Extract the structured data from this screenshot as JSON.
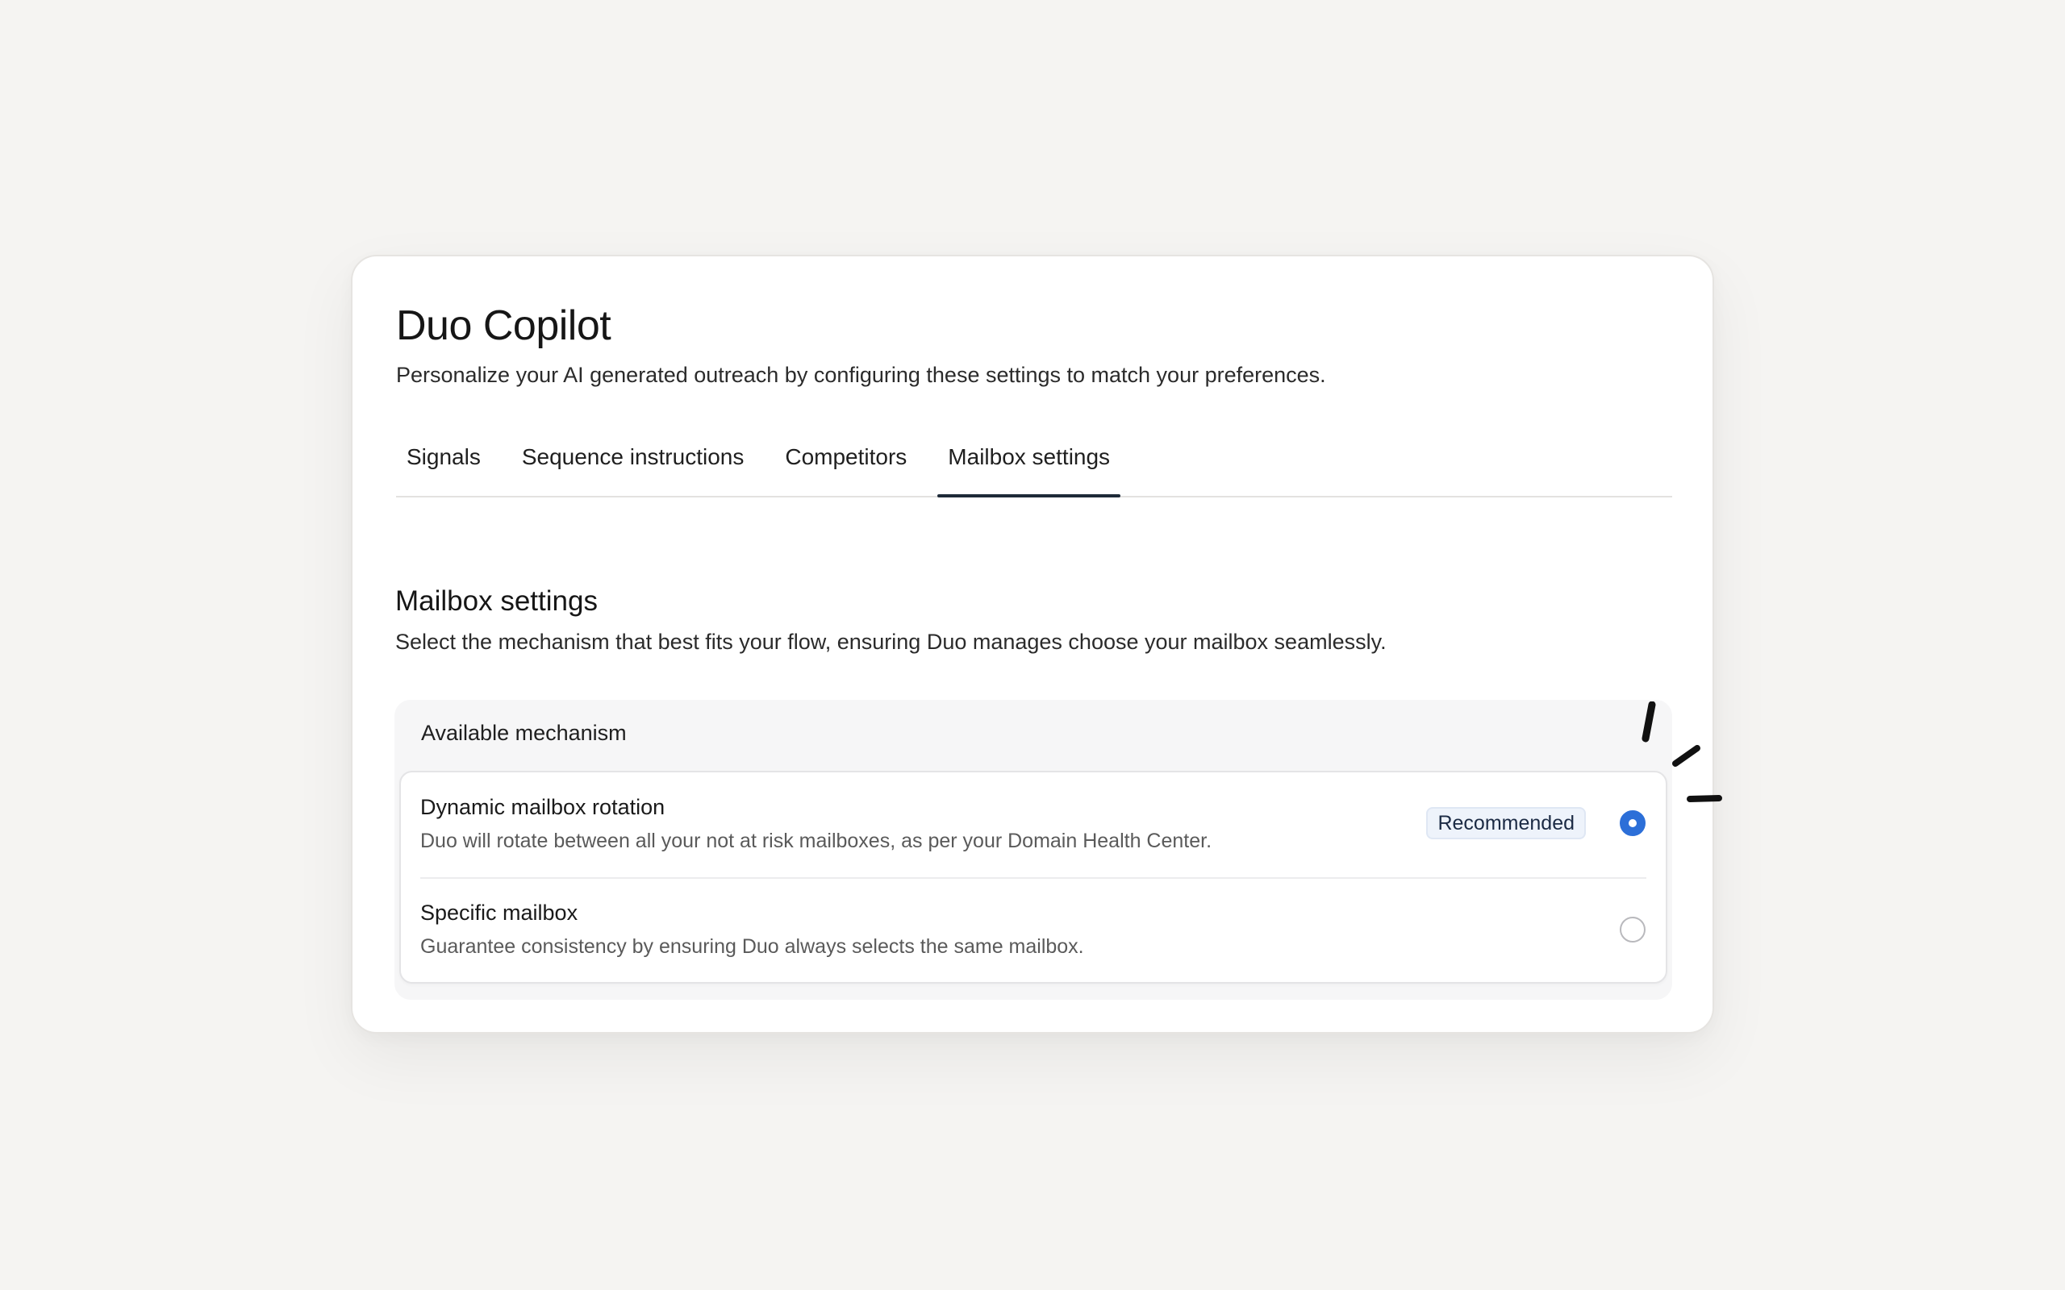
{
  "header": {
    "title": "Duo Copilot",
    "subtitle": "Personalize your AI generated outreach by configuring these settings to match your preferences."
  },
  "tabs": [
    {
      "label": "Signals",
      "active": false
    },
    {
      "label": "Sequence instructions",
      "active": false
    },
    {
      "label": "Competitors",
      "active": false
    },
    {
      "label": "Mailbox settings",
      "active": true
    }
  ],
  "section": {
    "title": "Mailbox settings",
    "description": "Select the mechanism that best fits your flow, ensuring Duo manages choose your mailbox seamlessly."
  },
  "mechanism": {
    "header": "Available mechanism",
    "options": [
      {
        "title": "Dynamic mailbox rotation",
        "description": "Duo will rotate between all your not at risk mailboxes, as per your Domain Health Center.",
        "badge": "Recommended",
        "selected": true
      },
      {
        "title": "Specific mailbox",
        "description": "Guarantee consistency by ensuring Duo always selects the same mailbox.",
        "selected": false
      }
    ]
  },
  "colors": {
    "accent": "#2c6fd8",
    "page_background": "#f5f4f2",
    "active_tab_underline": "#1e2a38",
    "badge_background": "#eef3fb"
  },
  "icons": {
    "decoration": "sparkle-strokes-icon"
  }
}
